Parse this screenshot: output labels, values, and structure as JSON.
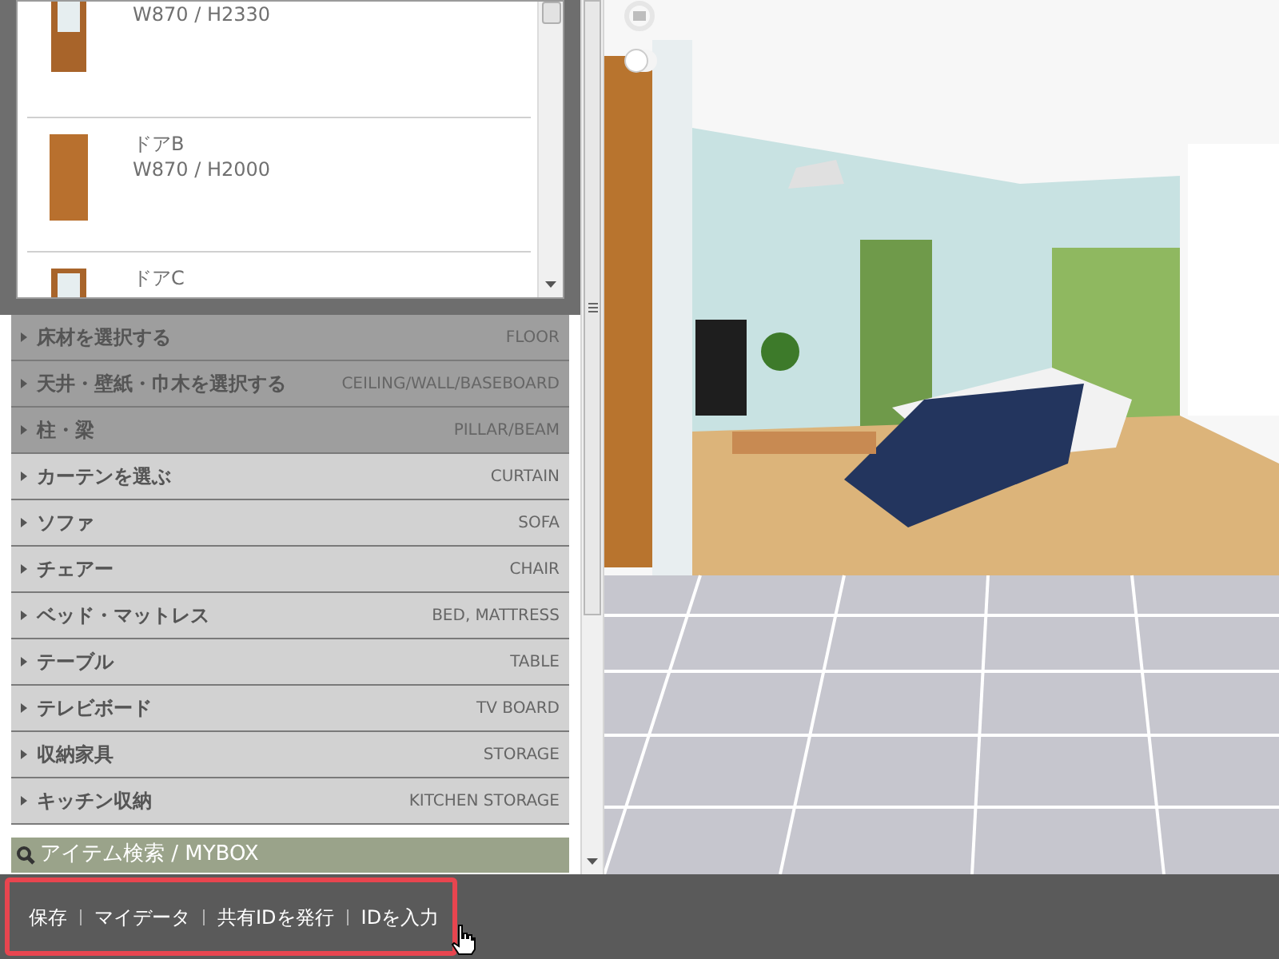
{
  "door_list": {
    "items": [
      {
        "dims": "W870 / H2330",
        "kind": "glass"
      },
      {
        "name": "ドアB",
        "dims": "W870 / H2000",
        "kind": "plain"
      },
      {
        "name": "ドアC",
        "kind": "glass"
      }
    ]
  },
  "categories": [
    {
      "label": "床材を選択する",
      "code": "FLOOR",
      "kind": "interior"
    },
    {
      "label": "天井・壁紙・巾木を選択する",
      "code": "CEILING/WALL/BASEBOARD",
      "kind": "interior"
    },
    {
      "label": "柱・梁",
      "code": "PILLAR/BEAM",
      "kind": "interior"
    },
    {
      "label": "カーテンを選ぶ",
      "code": "CURTAIN",
      "kind": "furniture"
    },
    {
      "label": "ソファ",
      "code": "SOFA",
      "kind": "furniture"
    },
    {
      "label": "チェアー",
      "code": "CHAIR",
      "kind": "furniture"
    },
    {
      "label": "ベッド・マットレス",
      "code": "BED, MATTRESS",
      "kind": "furniture"
    },
    {
      "label": "テーブル",
      "code": "TABLE",
      "kind": "furniture"
    },
    {
      "label": "テレビボード",
      "code": "TV BOARD",
      "kind": "furniture"
    },
    {
      "label": "収納家具",
      "code": "STORAGE",
      "kind": "furniture"
    },
    {
      "label": "キッチン収納",
      "code": "KITCHEN STORAGE",
      "kind": "furniture"
    }
  ],
  "search": {
    "label": "アイテム検索 / MYBOX"
  },
  "footer_links": [
    "保存",
    "マイデータ",
    "共有IDを発行",
    "IDを入力"
  ]
}
